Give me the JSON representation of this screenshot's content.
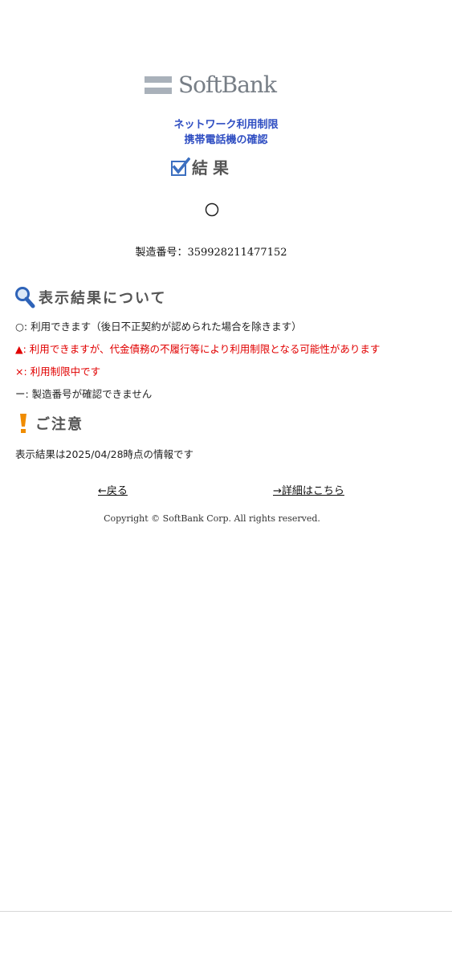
{
  "brand": {
    "name": "SoftBank"
  },
  "title": {
    "line1": "ネットワーク利用制限",
    "line2": "携帯電話機の確認"
  },
  "result": {
    "heading": "結果",
    "status_symbol": "○"
  },
  "serial": {
    "text": "製造番号：359928211477152"
  },
  "legend_section": {
    "heading": "表示結果について",
    "items": [
      "○: 利用できます（後日不正契約が認められた場合を除きます）",
      "▲: 利用できますが、代金債務の不履行等により利用制限となる可能性があります",
      "×: 利用制限中です",
      "ー: 製造番号が確認できません"
    ]
  },
  "notice_section": {
    "heading": "ご注意",
    "text": "表示結果は2025/04/28時点の情報です"
  },
  "links": {
    "back": "←戻る",
    "detail": "→詳細はこちら"
  },
  "footer": {
    "copyright": "Copyright © SoftBank Corp. All rights reserved."
  },
  "colors": {
    "title_blue": "#2f4ec2",
    "warning_red": "#e10000",
    "logo_gray": "#a9b1ba"
  },
  "icons": {
    "check": "checkbox-check-icon",
    "search": "magnifier-icon",
    "warning": "exclamation-icon"
  }
}
